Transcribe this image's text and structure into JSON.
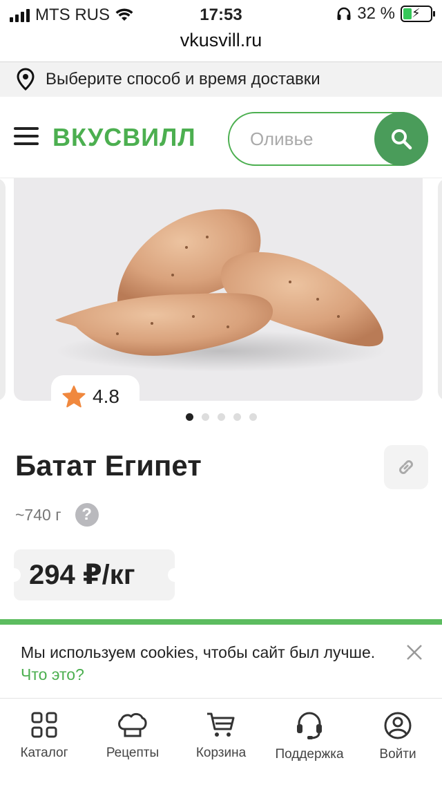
{
  "status_bar": {
    "carrier": "MTS RUS",
    "time": "17:53",
    "battery_percent": "32 %",
    "battery_level": 0.32
  },
  "browser": {
    "url": "vkusvill.ru"
  },
  "delivery": {
    "text": "Выберите способ и время доставки",
    "icon": "location-pin-icon"
  },
  "header": {
    "logo": "ВКУСВИЛЛ",
    "search_placeholder": "Оливье",
    "menu_icon": "hamburger-icon",
    "search_icon": "search-icon"
  },
  "gallery": {
    "rating": "4.8",
    "slides_count": 5,
    "active_slide": 1
  },
  "product": {
    "title": "Батат Египет",
    "weight": "~740 г",
    "price": "294 ₽/кг"
  },
  "cookie_banner": {
    "text": "Мы используем cookies, чтобы сайт был лучше.",
    "link": "Что это?"
  },
  "bottom_nav": [
    {
      "label": "Каталог",
      "icon": "catalog-grid-icon"
    },
    {
      "label": "Рецепты",
      "icon": "chef-hat-icon"
    },
    {
      "label": "Корзина",
      "icon": "cart-icon"
    },
    {
      "label": "Поддержка",
      "icon": "headset-icon"
    },
    {
      "label": "Войти",
      "icon": "user-icon"
    }
  ],
  "colors": {
    "brand_green": "#4caf50",
    "search_button": "#4a9c5a",
    "rating_star": "#f0883e"
  }
}
